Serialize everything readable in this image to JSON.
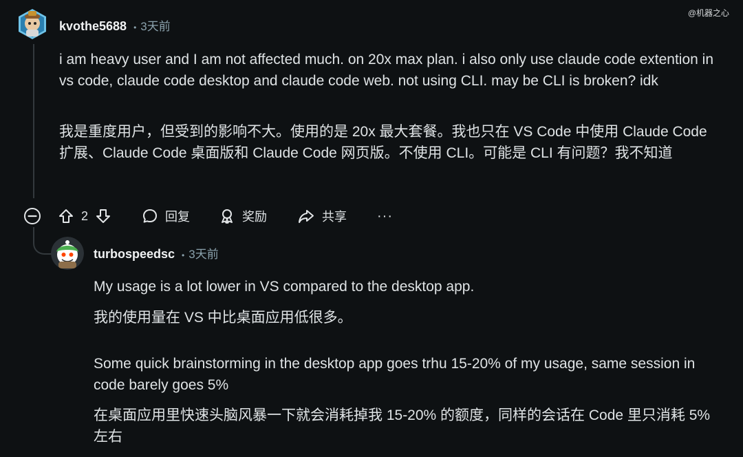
{
  "watermark": "@机器之心",
  "comment1": {
    "username": "kvothe5688",
    "dot": "•",
    "time": "3天前",
    "text_en": "i am heavy user and I am not affected much. on 20x max plan. i also only use claude code extention in vs code, claude code desktop and claude code web. not using CLI. may be CLI is broken? idk",
    "text_zh": "我是重度用户，但受到的影响不大。使用的是 20x 最大套餐。我也只在 VS Code 中使用 Claude Code 扩展、Claude Code 桌面版和 Claude Code 网页版。不使用 CLI。可能是 CLI 有问题？我不知道",
    "actions": {
      "vote_count": "2",
      "reply_label": "回复",
      "award_label": "奖励",
      "share_label": "共享",
      "more_label": "···"
    }
  },
  "comment2": {
    "username": "turbospeedsc",
    "dot": "•",
    "time": "3天前",
    "text1_en": "My usage is a lot lower in VS compared to the desktop app.",
    "text1_zh": "我的使用量在 VS 中比桌面应用低很多。",
    "text2_en": "Some quick brainstorming in the desktop app goes trhu 15-20% of my usage, same session in code barely goes 5%",
    "text2_zh": "在桌面应用里快速头脑风暴一下就会消耗掉我 15-20% 的额度，同样的会话在 Code 里只消耗 5% 左右"
  },
  "colors": {
    "background": "#0e1113",
    "text": "#dfe3e5",
    "meta": "#8ba2ad",
    "thread_line": "#33393d"
  }
}
